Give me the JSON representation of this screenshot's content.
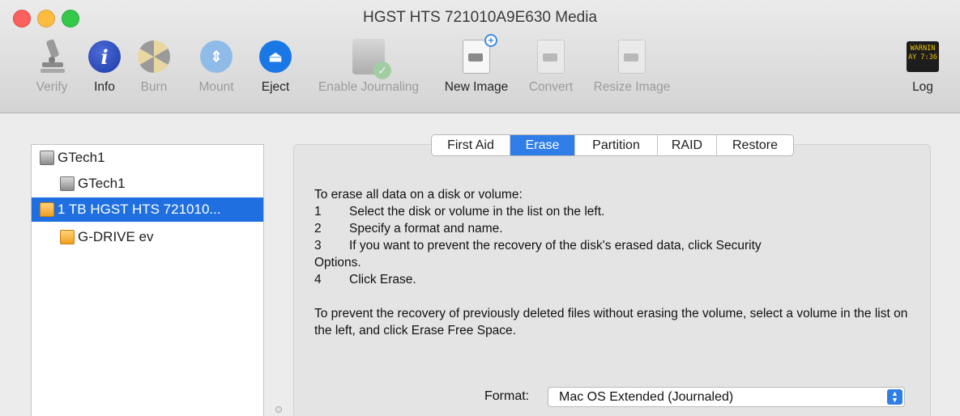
{
  "window": {
    "title": "HGST HTS 721010A9E630 Media"
  },
  "toolbar": {
    "verify": "Verify",
    "info": "Info",
    "burn": "Burn",
    "mount": "Mount",
    "eject": "Eject",
    "enable_journaling": "Enable Journaling",
    "new_image": "New Image",
    "convert": "Convert",
    "resize_image": "Resize Image",
    "log": "Log",
    "log_icon_line1": "WARNIN",
    "log_icon_line2": "AY 7:36",
    "info_glyph": "i"
  },
  "sidebar": {
    "items": [
      {
        "label": "GTech1",
        "icon": "disk-gray-icon"
      },
      {
        "label": "GTech1",
        "icon": "disk-gray-icon"
      },
      {
        "label": "1 TB HGST HTS 721010...",
        "icon": "disk-orange-icon",
        "selected": true
      },
      {
        "label": "G-DRIVE ev",
        "icon": "disk-orange-icon"
      }
    ]
  },
  "tabs": [
    "First Aid",
    "Erase",
    "Partition",
    "RAID",
    "Restore"
  ],
  "active_tab": "Erase",
  "erase": {
    "intro": "To erase all data on a disk or volume:",
    "steps": [
      {
        "num": "1",
        "text": "Select the disk or volume in the list on the left."
      },
      {
        "num": "2",
        "text": "Specify a format and name."
      },
      {
        "num": "3",
        "text": "If you want to prevent the recovery of the disk's erased data, click Security"
      },
      {
        "num": "",
        "text": "Options."
      },
      {
        "num": "4",
        "text": "Click Erase."
      }
    ],
    "free_space_note": "To prevent the recovery of previously deleted files without erasing the volume, select a volume in the list on the left, and click Erase Free Space.",
    "format_label": "Format:",
    "format_value": "Mac OS Extended (Journaled)"
  },
  "colors": {
    "selection": "#1f6fe0",
    "tab_active": "#2f7ee8",
    "disabled_text": "#9b9b9b"
  }
}
